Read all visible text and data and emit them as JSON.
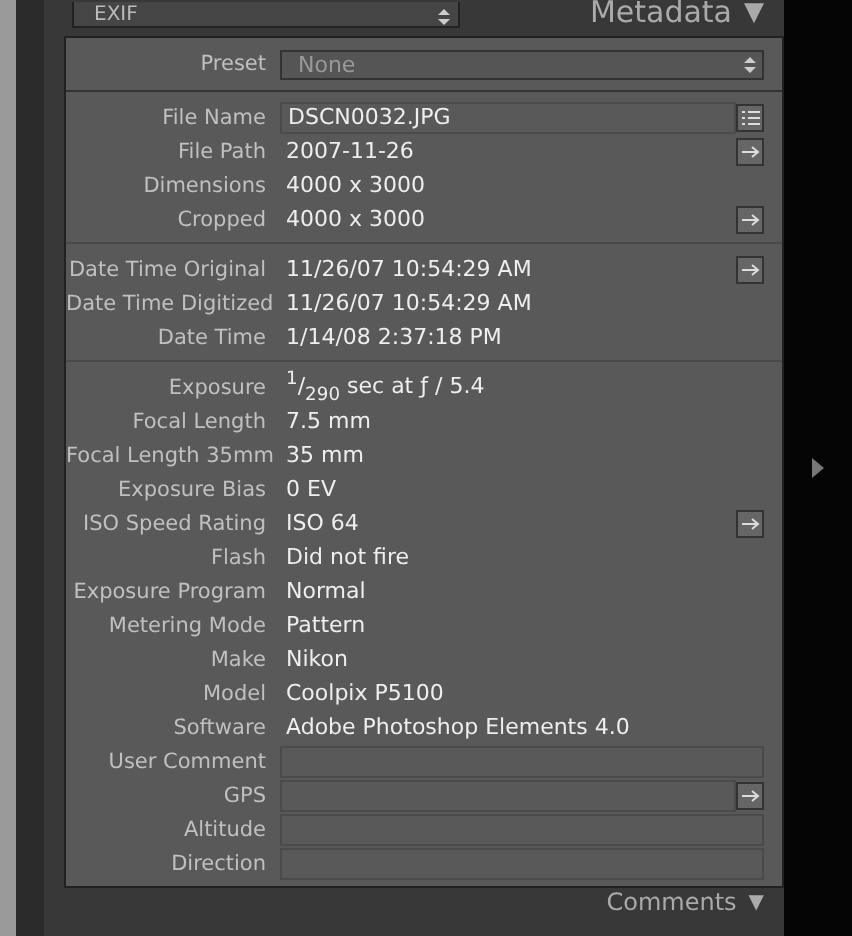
{
  "header": {
    "dropdown": "EXIF",
    "title": "Metadata",
    "caret": "▼"
  },
  "preset": {
    "label": "Preset",
    "value": "None"
  },
  "sections": [
    [
      {
        "label": "File Name",
        "value": "DSCN0032.JPG",
        "kind": "field",
        "list_button": true
      },
      {
        "label": "File Path",
        "value": "2007-11-26",
        "kind": "text",
        "arrow_button": true
      },
      {
        "label": "Dimensions",
        "value": "4000 x 3000",
        "kind": "text"
      },
      {
        "label": "Cropped",
        "value": "4000 x 3000",
        "kind": "text",
        "arrow_button": true
      }
    ],
    [
      {
        "label": "Date Time Original",
        "value": "11/26/07 10:54:29 AM",
        "kind": "text",
        "arrow_button": true
      },
      {
        "label": "Date Time Digitized",
        "value": "11/26/07 10:54:29 AM",
        "kind": "text"
      },
      {
        "label": "Date Time",
        "value": "1/14/08 2:37:18 PM",
        "kind": "text"
      }
    ],
    [
      {
        "label": "Exposure",
        "value": "$^{1}$/$_{290}$ sec at ƒ / 5.4",
        "kind": "text"
      },
      {
        "label": "Focal Length",
        "value": "7.5 mm",
        "kind": "text"
      },
      {
        "label": "Focal Length 35mm",
        "value": "35 mm",
        "kind": "text"
      },
      {
        "label": "Exposure Bias",
        "value": "0 EV",
        "kind": "text"
      },
      {
        "label": "ISO Speed Rating",
        "value": "ISO 64",
        "kind": "text",
        "arrow_button": true
      },
      {
        "label": "Flash",
        "value": "Did not fire",
        "kind": "text"
      },
      {
        "label": "Exposure Program",
        "value": "Normal",
        "kind": "text"
      },
      {
        "label": "Metering Mode",
        "value": "Pattern",
        "kind": "text"
      },
      {
        "label": "Make",
        "value": "Nikon",
        "kind": "text"
      },
      {
        "label": "Model",
        "value": "Coolpix P5100",
        "kind": "text"
      },
      {
        "label": "Software",
        "value": "Adobe Photoshop Elements 4.0",
        "kind": "text"
      },
      {
        "label": "User Comment",
        "kind": "field"
      },
      {
        "label": "GPS",
        "kind": "field",
        "arrow_button": true
      },
      {
        "label": "Altitude",
        "kind": "field"
      },
      {
        "label": "Direction",
        "kind": "field"
      }
    ]
  ],
  "footer": {
    "title": "Comments",
    "caret": "▼"
  }
}
